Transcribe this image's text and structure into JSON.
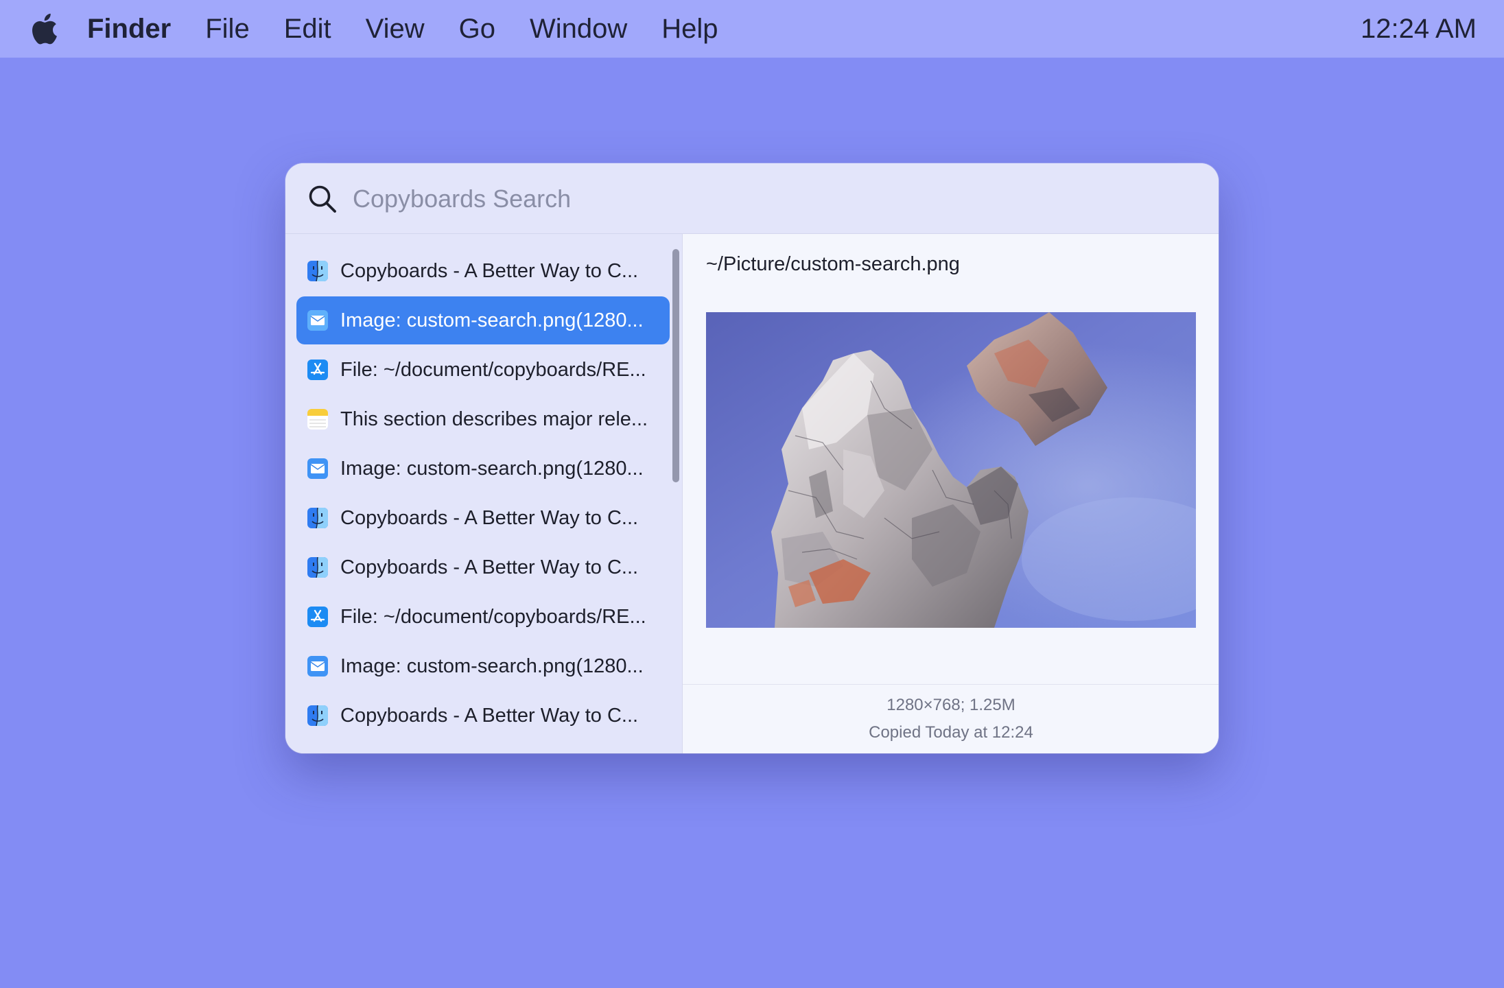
{
  "menubar": {
    "app_name": "Finder",
    "items": [
      "File",
      "Edit",
      "View",
      "Go",
      "Window",
      "Help"
    ],
    "clock": "12:24 AM"
  },
  "search": {
    "placeholder": "Copyboards Search",
    "value": ""
  },
  "list": {
    "selected_index": 1,
    "items": [
      {
        "icon": "finder-icon",
        "label": "Copyboards - A Better Way to C..."
      },
      {
        "icon": "mail-icon",
        "label": "Image: custom-search.png(1280..."
      },
      {
        "icon": "app-store-icon",
        "label": "File: ~/document/copyboards/RE..."
      },
      {
        "icon": "notes-icon",
        "label": "This section describes major rele..."
      },
      {
        "icon": "mail-icon",
        "label": "Image: custom-search.png(1280..."
      },
      {
        "icon": "finder-icon",
        "label": "Copyboards - A Better Way to C..."
      },
      {
        "icon": "finder-icon",
        "label": "Copyboards - A Better Way to C..."
      },
      {
        "icon": "app-store-icon",
        "label": "File: ~/document/copyboards/RE..."
      },
      {
        "icon": "mail-icon",
        "label": "Image: custom-search.png(1280..."
      },
      {
        "icon": "finder-icon",
        "label": "Copyboards - A Better Way to C..."
      }
    ]
  },
  "preview": {
    "path": "~/Picture/custom-search.png",
    "image_description_icon": "rock-photo",
    "dimensions": "1280×768; 1.25M",
    "copied": "Copied Today at 12:24"
  },
  "colors": {
    "desktop": "#838cf4",
    "menubar": "#a1a8fb",
    "selection": "#3d82f0"
  }
}
